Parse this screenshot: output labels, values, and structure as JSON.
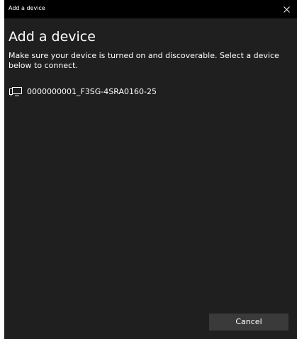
{
  "window": {
    "title": "Add a device"
  },
  "page": {
    "heading": "Add a device",
    "description": "Make sure your device is turned on and discoverable. Select a device below to connect."
  },
  "devices": [
    {
      "name": "0000000001_F3SG-4SRA0160-25",
      "icon": "display-device-icon"
    }
  ],
  "footer": {
    "cancel_label": "Cancel"
  },
  "colors": {
    "background": "#1f1f1f",
    "titlebar": "#000000",
    "button": "#3a3a3a",
    "text": "#ffffff"
  }
}
